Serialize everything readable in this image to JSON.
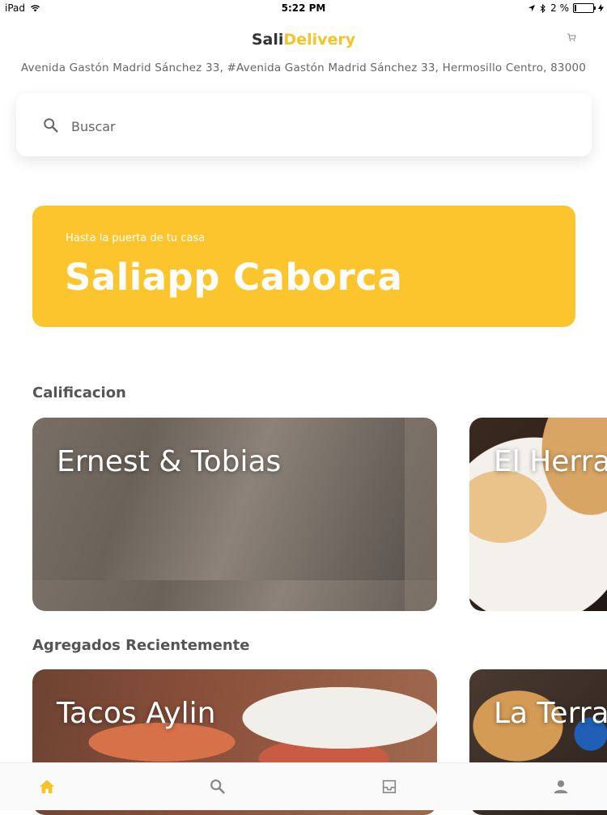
{
  "status_bar": {
    "device": "iPad",
    "time": "5:22 PM",
    "battery": "2 %"
  },
  "header": {
    "brand_part1": "Sali",
    "brand_part2": "Delivery",
    "address": "Avenida Gastón Madrid Sánchez 33, #Avenida Gastón Madrid Sánchez 33, Hermosillo Centro, 83000"
  },
  "search": {
    "placeholder": "Buscar",
    "value": ""
  },
  "banner": {
    "subtitle": "Hasta la puerta de tu casa",
    "title": "Saliapp Caborca"
  },
  "sections": [
    {
      "title": "Calificacion",
      "cards": [
        {
          "name": "Ernest & Tobias"
        },
        {
          "name": "El Herra"
        }
      ]
    },
    {
      "title": "Agregados Recientemente",
      "cards": [
        {
          "name": "Tacos Aylin"
        },
        {
          "name": "La Terra"
        }
      ]
    }
  ],
  "colors": {
    "accent": "#FCC52E",
    "brand_dark": "#333333",
    "nav_active": "#F6C328",
    "nav_inactive": "#888888"
  },
  "bottom_nav": [
    {
      "icon": "home-icon",
      "active": true
    },
    {
      "icon": "search-icon",
      "active": false
    },
    {
      "icon": "inbox-icon",
      "active": false
    },
    {
      "icon": "user-icon",
      "active": false
    }
  ]
}
